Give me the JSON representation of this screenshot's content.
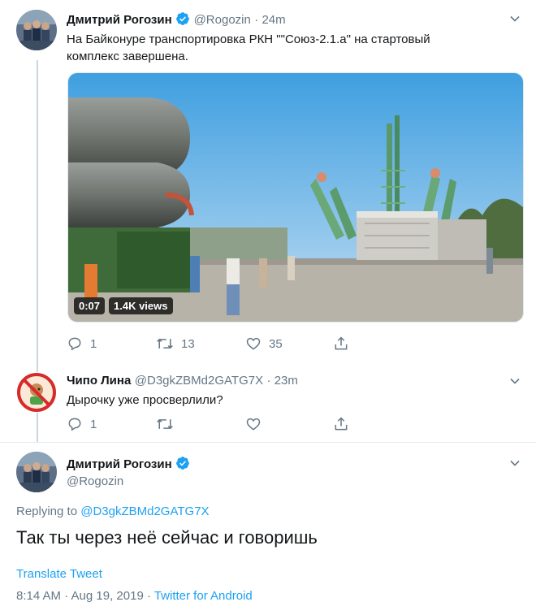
{
  "tweet1": {
    "name": "Дмитрий Рогозин",
    "handle": "@Rogozin",
    "time": "· 24m",
    "text_line1": "На Байконуре транспортировка РКН \"\"Союз-2.1.а\" на стартовый",
    "text_line2": "комплекс завершена.",
    "video_duration": "0:07",
    "video_views": "1.4K views",
    "replies": "1",
    "retweets": "13",
    "likes": "35"
  },
  "reply": {
    "name": "Чипо Лина",
    "handle": "@D3gkZBMd2GATG7X",
    "time": "· 23m",
    "text": "Дырочку уже просверлили?",
    "replies": "1"
  },
  "main": {
    "name": "Дмитрий Рогозин",
    "handle": "@Rogozin",
    "replying_prefix": "Replying to ",
    "replying_to": "@D3gkZBMd2GATG7X",
    "text": "Так ты через неё сейчас и говоришь",
    "translate": "Translate Tweet",
    "timestamp": "8:14 AM · Aug 19, 2019 · ",
    "source": "Twitter for Android"
  },
  "colors": {
    "accent": "#1da1f2",
    "muted": "#657786",
    "text": "#14171a"
  },
  "icons": [
    "verified-icon",
    "chevron-down-icon",
    "reply-icon",
    "retweet-icon",
    "like-icon",
    "share-icon"
  ]
}
